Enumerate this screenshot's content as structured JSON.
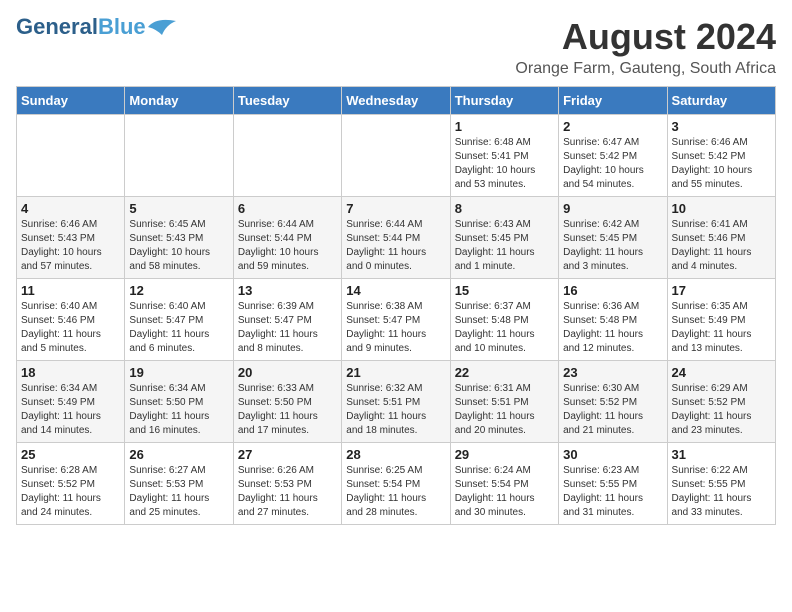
{
  "header": {
    "logo_general": "General",
    "logo_blue": "Blue",
    "main_title": "August 2024",
    "subtitle": "Orange Farm, Gauteng, South Africa"
  },
  "days_of_week": [
    "Sunday",
    "Monday",
    "Tuesday",
    "Wednesday",
    "Thursday",
    "Friday",
    "Saturday"
  ],
  "weeks": [
    [
      {
        "day": "",
        "info": ""
      },
      {
        "day": "",
        "info": ""
      },
      {
        "day": "",
        "info": ""
      },
      {
        "day": "",
        "info": ""
      },
      {
        "day": "1",
        "info": "Sunrise: 6:48 AM\nSunset: 5:41 PM\nDaylight: 10 hours\nand 53 minutes."
      },
      {
        "day": "2",
        "info": "Sunrise: 6:47 AM\nSunset: 5:42 PM\nDaylight: 10 hours\nand 54 minutes."
      },
      {
        "day": "3",
        "info": "Sunrise: 6:46 AM\nSunset: 5:42 PM\nDaylight: 10 hours\nand 55 minutes."
      }
    ],
    [
      {
        "day": "4",
        "info": "Sunrise: 6:46 AM\nSunset: 5:43 PM\nDaylight: 10 hours\nand 57 minutes."
      },
      {
        "day": "5",
        "info": "Sunrise: 6:45 AM\nSunset: 5:43 PM\nDaylight: 10 hours\nand 58 minutes."
      },
      {
        "day": "6",
        "info": "Sunrise: 6:44 AM\nSunset: 5:44 PM\nDaylight: 10 hours\nand 59 minutes."
      },
      {
        "day": "7",
        "info": "Sunrise: 6:44 AM\nSunset: 5:44 PM\nDaylight: 11 hours\nand 0 minutes."
      },
      {
        "day": "8",
        "info": "Sunrise: 6:43 AM\nSunset: 5:45 PM\nDaylight: 11 hours\nand 1 minute."
      },
      {
        "day": "9",
        "info": "Sunrise: 6:42 AM\nSunset: 5:45 PM\nDaylight: 11 hours\nand 3 minutes."
      },
      {
        "day": "10",
        "info": "Sunrise: 6:41 AM\nSunset: 5:46 PM\nDaylight: 11 hours\nand 4 minutes."
      }
    ],
    [
      {
        "day": "11",
        "info": "Sunrise: 6:40 AM\nSunset: 5:46 PM\nDaylight: 11 hours\nand 5 minutes."
      },
      {
        "day": "12",
        "info": "Sunrise: 6:40 AM\nSunset: 5:47 PM\nDaylight: 11 hours\nand 6 minutes."
      },
      {
        "day": "13",
        "info": "Sunrise: 6:39 AM\nSunset: 5:47 PM\nDaylight: 11 hours\nand 8 minutes."
      },
      {
        "day": "14",
        "info": "Sunrise: 6:38 AM\nSunset: 5:47 PM\nDaylight: 11 hours\nand 9 minutes."
      },
      {
        "day": "15",
        "info": "Sunrise: 6:37 AM\nSunset: 5:48 PM\nDaylight: 11 hours\nand 10 minutes."
      },
      {
        "day": "16",
        "info": "Sunrise: 6:36 AM\nSunset: 5:48 PM\nDaylight: 11 hours\nand 12 minutes."
      },
      {
        "day": "17",
        "info": "Sunrise: 6:35 AM\nSunset: 5:49 PM\nDaylight: 11 hours\nand 13 minutes."
      }
    ],
    [
      {
        "day": "18",
        "info": "Sunrise: 6:34 AM\nSunset: 5:49 PM\nDaylight: 11 hours\nand 14 minutes."
      },
      {
        "day": "19",
        "info": "Sunrise: 6:34 AM\nSunset: 5:50 PM\nDaylight: 11 hours\nand 16 minutes."
      },
      {
        "day": "20",
        "info": "Sunrise: 6:33 AM\nSunset: 5:50 PM\nDaylight: 11 hours\nand 17 minutes."
      },
      {
        "day": "21",
        "info": "Sunrise: 6:32 AM\nSunset: 5:51 PM\nDaylight: 11 hours\nand 18 minutes."
      },
      {
        "day": "22",
        "info": "Sunrise: 6:31 AM\nSunset: 5:51 PM\nDaylight: 11 hours\nand 20 minutes."
      },
      {
        "day": "23",
        "info": "Sunrise: 6:30 AM\nSunset: 5:52 PM\nDaylight: 11 hours\nand 21 minutes."
      },
      {
        "day": "24",
        "info": "Sunrise: 6:29 AM\nSunset: 5:52 PM\nDaylight: 11 hours\nand 23 minutes."
      }
    ],
    [
      {
        "day": "25",
        "info": "Sunrise: 6:28 AM\nSunset: 5:52 PM\nDaylight: 11 hours\nand 24 minutes."
      },
      {
        "day": "26",
        "info": "Sunrise: 6:27 AM\nSunset: 5:53 PM\nDaylight: 11 hours\nand 25 minutes."
      },
      {
        "day": "27",
        "info": "Sunrise: 6:26 AM\nSunset: 5:53 PM\nDaylight: 11 hours\nand 27 minutes."
      },
      {
        "day": "28",
        "info": "Sunrise: 6:25 AM\nSunset: 5:54 PM\nDaylight: 11 hours\nand 28 minutes."
      },
      {
        "day": "29",
        "info": "Sunrise: 6:24 AM\nSunset: 5:54 PM\nDaylight: 11 hours\nand 30 minutes."
      },
      {
        "day": "30",
        "info": "Sunrise: 6:23 AM\nSunset: 5:55 PM\nDaylight: 11 hours\nand 31 minutes."
      },
      {
        "day": "31",
        "info": "Sunrise: 6:22 AM\nSunset: 5:55 PM\nDaylight: 11 hours\nand 33 minutes."
      }
    ]
  ]
}
